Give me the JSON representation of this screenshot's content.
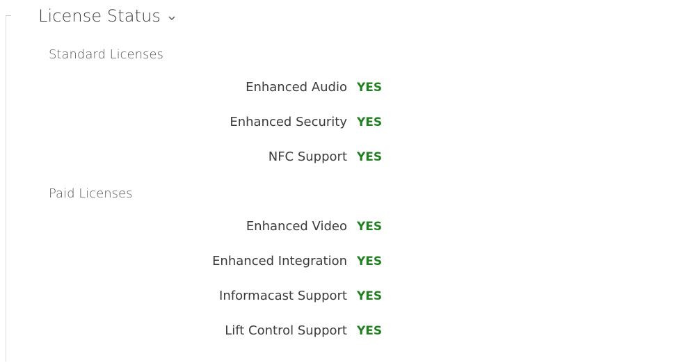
{
  "section": {
    "title": "License Status",
    "icon": "chevron-down-icon"
  },
  "standard": {
    "title": "Standard Licenses",
    "items": [
      {
        "label": "Enhanced Audio",
        "value": "YES"
      },
      {
        "label": "Enhanced Security",
        "value": "YES"
      },
      {
        "label": "NFC Support",
        "value": "YES"
      }
    ]
  },
  "paid": {
    "title": "Paid Licenses",
    "items": [
      {
        "label": "Enhanced Video",
        "value": "YES"
      },
      {
        "label": "Enhanced Integration",
        "value": "YES"
      },
      {
        "label": "Informacast Support",
        "value": "YES"
      },
      {
        "label": "Lift Control Support",
        "value": "YES"
      }
    ]
  },
  "colors": {
    "status_yes": "#208020",
    "label_text": "#3a3a3a",
    "heading_text": "#3c3c3c"
  }
}
